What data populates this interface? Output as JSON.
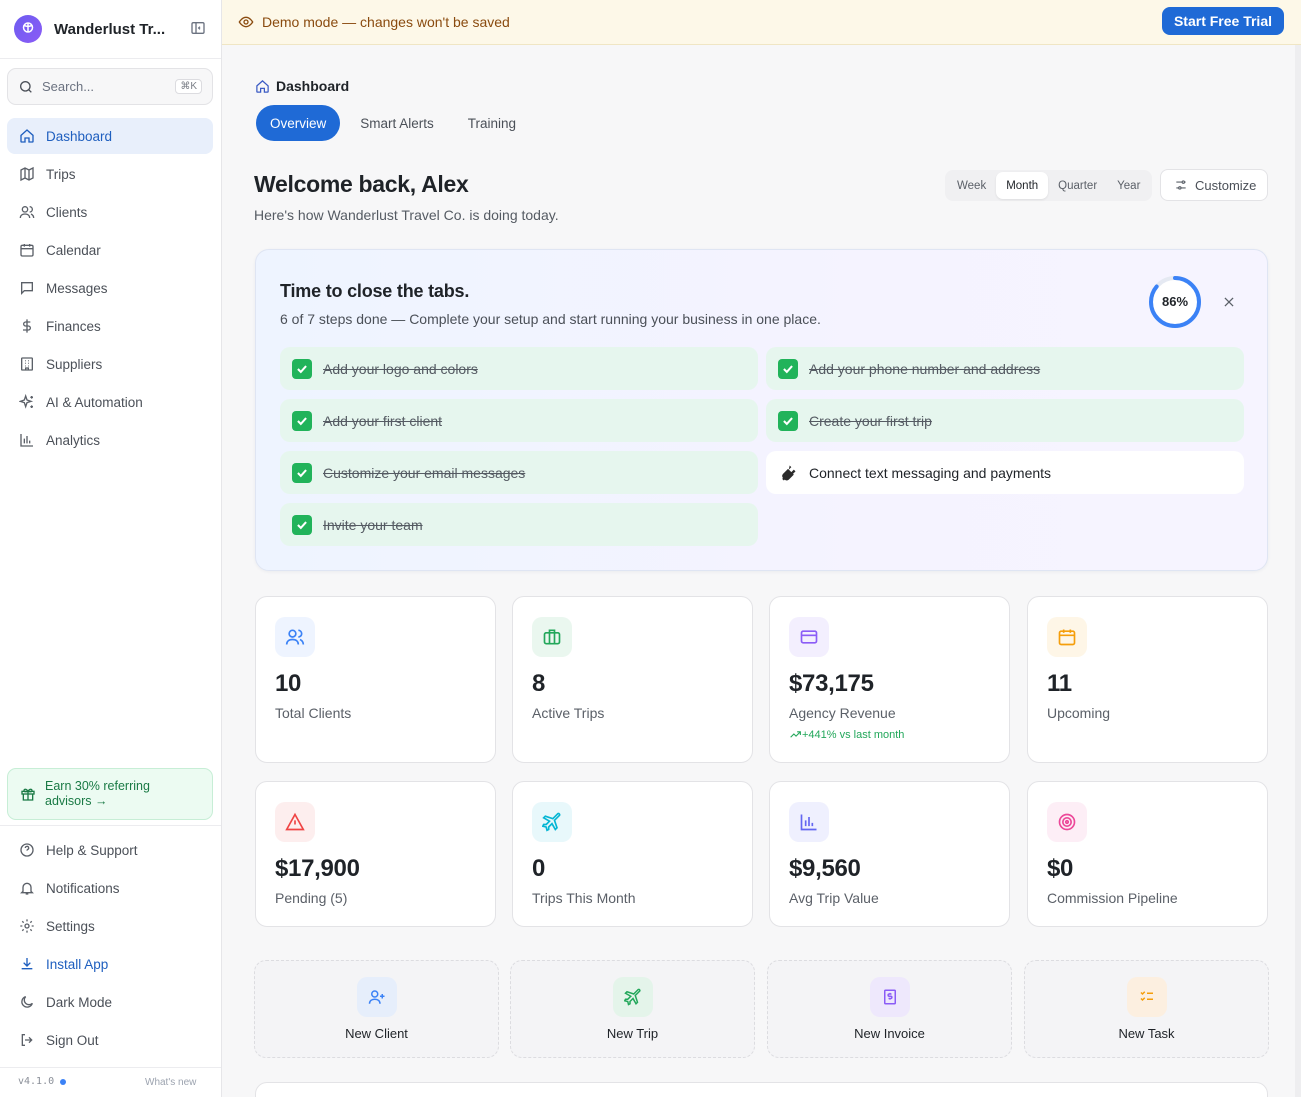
{
  "sidebar": {
    "brand": "Wanderlust Tr...",
    "search_placeholder": "Search...",
    "search_shortcut": "⌘K",
    "items": [
      {
        "label": "Dashboard",
        "icon": "home-icon",
        "active": true
      },
      {
        "label": "Trips",
        "icon": "map-icon"
      },
      {
        "label": "Clients",
        "icon": "users-icon"
      },
      {
        "label": "Calendar",
        "icon": "calendar-icon"
      },
      {
        "label": "Messages",
        "icon": "message-icon"
      },
      {
        "label": "Finances",
        "icon": "dollar-icon"
      },
      {
        "label": "Suppliers",
        "icon": "building-icon"
      },
      {
        "label": "AI & Automation",
        "icon": "sparkles-icon"
      },
      {
        "label": "Analytics",
        "icon": "bar-chart-icon"
      }
    ],
    "promo": {
      "line1": "Earn 30% referring",
      "line2": "advisors →"
    },
    "bottom_items": [
      {
        "label": "Help & Support",
        "icon": "help-icon"
      },
      {
        "label": "Notifications",
        "icon": "bell-icon"
      },
      {
        "label": "Settings",
        "icon": "gear-icon"
      },
      {
        "label": "Install App",
        "icon": "download-icon"
      },
      {
        "label": "Dark Mode",
        "icon": "moon-icon"
      },
      {
        "label": "Sign Out",
        "icon": "sign-out-icon"
      }
    ],
    "version": "v4.1.0",
    "whats_new": "What's new"
  },
  "banner": {
    "text": "Demo mode — changes won't be saved",
    "cta": "Start Free Trial"
  },
  "main": {
    "breadcrumb": "Dashboard",
    "tabs": [
      {
        "label": "Overview",
        "active": true
      },
      {
        "label": "Smart Alerts"
      },
      {
        "label": "Training"
      }
    ],
    "welcome": "Welcome back, Alex",
    "subtitle": "Here's how Wanderlust Travel Co. is doing today.",
    "periods": [
      {
        "label": "Week"
      },
      {
        "label": "Month",
        "active": true
      },
      {
        "label": "Quarter"
      },
      {
        "label": "Year"
      }
    ],
    "customize": "Customize"
  },
  "setup": {
    "title": "Time to close the tabs.",
    "subtitle": "6 of 7 steps done — Complete your setup and start running your business in one place.",
    "progress_label": "86%",
    "progress": 0.86,
    "steps": [
      {
        "label": "Add your logo and colors",
        "done": true
      },
      {
        "label": "Add your phone number and address",
        "done": true
      },
      {
        "label": "Add your first client",
        "done": true
      },
      {
        "label": "Create your first trip",
        "done": true
      },
      {
        "label": "Customize your email messages",
        "done": true
      },
      {
        "label": "Connect text messaging and payments",
        "done": false
      },
      {
        "label": "Invite your team",
        "done": true
      }
    ]
  },
  "stats": [
    {
      "value": "10",
      "label": "Total Clients",
      "icon": "users-icon",
      "color": "#3b82f6"
    },
    {
      "value": "8",
      "label": "Active Trips",
      "icon": "briefcase-icon",
      "color": "#22a75a"
    },
    {
      "value": "$73,175",
      "label": "Agency Revenue",
      "icon": "credit-card-icon",
      "color": "#8b5cf6",
      "trend": "+441% vs last month"
    },
    {
      "value": "11",
      "label": "Upcoming",
      "icon": "calendar-icon",
      "color": "#f59e0b"
    },
    {
      "value": "$17,900",
      "label": "Pending (5)",
      "icon": "alert-triangle-icon",
      "color": "#ef4444"
    },
    {
      "value": "0",
      "label": "Trips This Month",
      "icon": "plane-icon",
      "color": "#06b6d4"
    },
    {
      "value": "$9,560",
      "label": "Avg Trip Value",
      "icon": "bar-chart-icon",
      "color": "#6366f1"
    },
    {
      "value": "$0",
      "label": "Commission Pipeline",
      "icon": "target-icon",
      "color": "#ec4899"
    }
  ],
  "quick_actions": [
    {
      "label": "New Client",
      "icon": "user-plus-icon",
      "color": "#3b82f6"
    },
    {
      "label": "New Trip",
      "icon": "plane-icon",
      "color": "#22a75a"
    },
    {
      "label": "New Invoice",
      "icon": "invoice-icon",
      "color": "#8b5cf6"
    },
    {
      "label": "New Task",
      "icon": "checklist-icon",
      "color": "#f59e0b"
    }
  ]
}
